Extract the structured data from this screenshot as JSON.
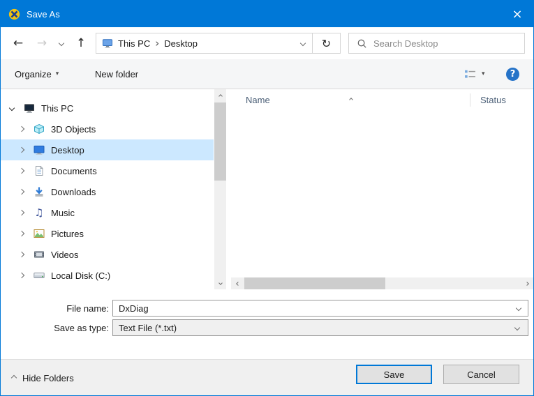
{
  "window": {
    "title": "Save As"
  },
  "icons": {
    "back": "←",
    "forward": "→",
    "up": "↑",
    "refresh": "↻",
    "close": "×",
    "caret_down": "▾",
    "breadcrumb_separator": "›",
    "music_note": "♫",
    "help": "?"
  },
  "nav": {
    "breadcrumb": [
      {
        "label": "This PC"
      },
      {
        "label": "Desktop"
      }
    ],
    "search_placeholder": "Search Desktop"
  },
  "toolbar": {
    "organize_label": "Organize",
    "new_folder_label": "New folder"
  },
  "tree": {
    "items": [
      {
        "label": "This PC",
        "expanded": true,
        "selected": false
      },
      {
        "label": "3D Objects",
        "expanded": false,
        "selected": false
      },
      {
        "label": "Desktop",
        "expanded": false,
        "selected": true
      },
      {
        "label": "Documents",
        "expanded": false,
        "selected": false
      },
      {
        "label": "Downloads",
        "expanded": false,
        "selected": false
      },
      {
        "label": "Music",
        "expanded": false,
        "selected": false
      },
      {
        "label": "Pictures",
        "expanded": false,
        "selected": false
      },
      {
        "label": "Videos",
        "expanded": false,
        "selected": false
      },
      {
        "label": "Local Disk (C:)",
        "expanded": false,
        "selected": false
      }
    ]
  },
  "list": {
    "columns": [
      {
        "label": "Name"
      },
      {
        "label": "Status"
      }
    ],
    "items": []
  },
  "form": {
    "file_name_label": "File name:",
    "file_name_value": "DxDiag",
    "save_as_type_label": "Save as type:",
    "save_as_type_value": "Text File (*.txt)"
  },
  "footer": {
    "hide_folders_label": "Hide Folders",
    "save_label": "Save",
    "cancel_label": "Cancel"
  },
  "colors": {
    "titlebar": "#0078d7",
    "selection": "#cce8ff",
    "accent_border": "#0078d7"
  }
}
